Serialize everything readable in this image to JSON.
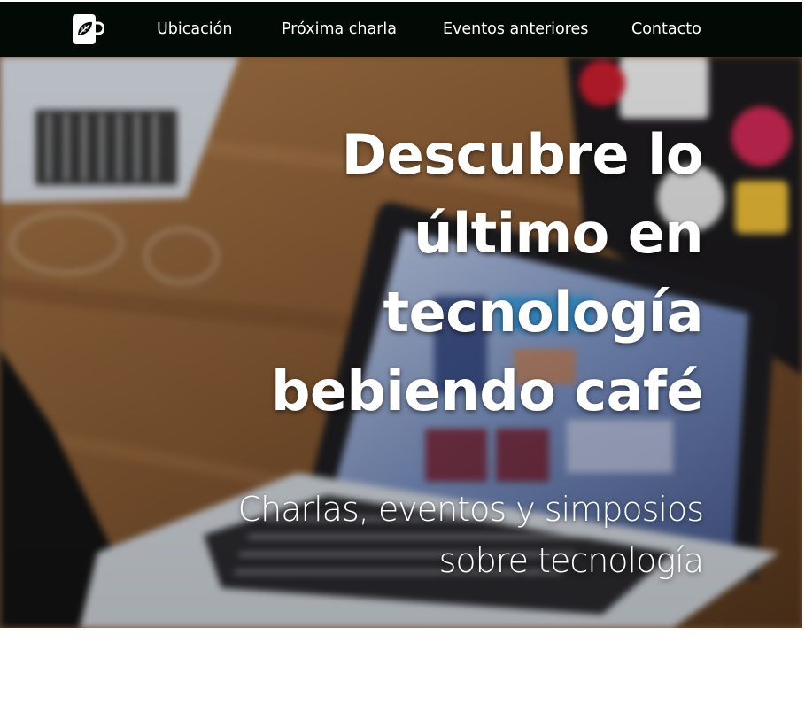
{
  "navbar": {
    "logo_icon": "coffee-cup-leaf-icon",
    "items": [
      {
        "label": "Ubicación"
      },
      {
        "label": "Próxima charla"
      },
      {
        "label": "Eventos anteriores"
      },
      {
        "label": "Contacto"
      }
    ]
  },
  "hero": {
    "title_lines": [
      "Descubre lo",
      "último en",
      "tecnología",
      "bebiendo café"
    ],
    "subtitle_lines": [
      "Charlas, eventos y simposios",
      "sobre tecnología"
    ]
  },
  "colors": {
    "navbar_bg": "#030a06",
    "text": "#ffffff",
    "page_bg": "#ffffff"
  }
}
